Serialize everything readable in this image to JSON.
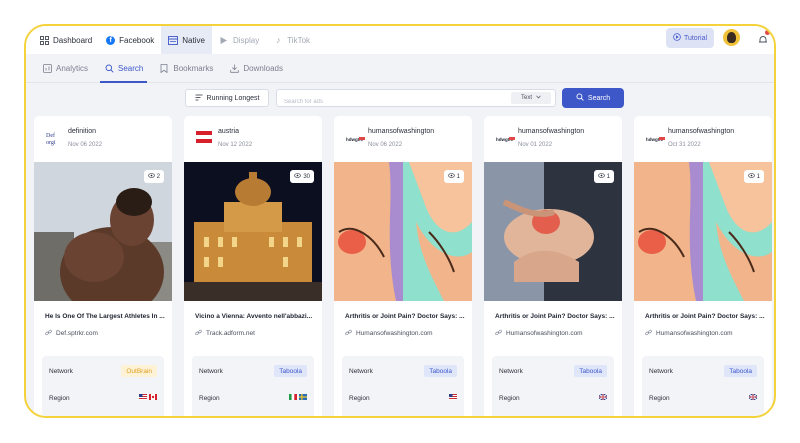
{
  "colors": {
    "accent": "#3d57c9",
    "frame": "#f3d23b",
    "taboola_bg": "#dfe6fa",
    "outbrain_text": "#e0a020"
  },
  "topnav": {
    "tabs": [
      {
        "label": "Dashboard",
        "icon": "grid-icon",
        "state": "normal"
      },
      {
        "label": "Facebook",
        "icon": "facebook-icon",
        "state": "normal"
      },
      {
        "label": "Native",
        "icon": "native-icon",
        "state": "active"
      },
      {
        "label": "Display",
        "icon": "play-icon",
        "state": "disabled"
      },
      {
        "label": "TikTok",
        "icon": "tiktok-icon",
        "state": "disabled"
      }
    ],
    "tutorial_label": "Tutorial"
  },
  "subnav": {
    "tabs": [
      {
        "label": "Analytics",
        "icon": "analytics-icon",
        "state": "normal"
      },
      {
        "label": "Search",
        "icon": "search-icon",
        "state": "active"
      },
      {
        "label": "Bookmarks",
        "icon": "bookmark-icon",
        "state": "normal"
      },
      {
        "label": "Downloads",
        "icon": "download-icon",
        "state": "normal"
      }
    ]
  },
  "search": {
    "sort_label": "Running Longest",
    "placeholder": "Search for ads",
    "type_value": "Text",
    "button_label": "Search"
  },
  "labels": {
    "network": "Network",
    "region": "Region"
  },
  "cards": [
    {
      "brand": "definition",
      "date": "Nov 06 2022",
      "views": "2",
      "title": "He Is One Of The Largest Athletes In ...",
      "url": "Def.sptrkr.com",
      "network": "OutBrain",
      "network_type": "outbrain",
      "flags": [
        "us",
        "ca"
      ],
      "image": "athlete",
      "logo": "def"
    },
    {
      "brand": "austria",
      "date": "Nov 12 2022",
      "views": "30",
      "title": "Vicino a Vienna: Avvento nell'abbazi...",
      "url": "Track.adform.net",
      "network": "Taboola",
      "network_type": "taboola",
      "flags": [
        "it",
        "se"
      ],
      "image": "palace",
      "logo": "austria"
    },
    {
      "brand": "humansofwashington",
      "date": "Nov 06 2022",
      "views": "1",
      "title": "Arthritis or Joint Pain? Doctor Says: ...",
      "url": "Humansofwashington.com",
      "network": "Taboola",
      "network_type": "taboola",
      "flags": [
        "us"
      ],
      "image": "illustration",
      "logo": "how"
    },
    {
      "brand": "humansofwashington",
      "date": "Nov 01 2022",
      "views": "1",
      "title": "Arthritis or Joint Pain? Doctor Says: ...",
      "url": "Humansofwashington.com",
      "network": "Taboola",
      "network_type": "taboola",
      "flags": [
        "gb"
      ],
      "image": "knee",
      "logo": "how"
    },
    {
      "brand": "humansofwashington",
      "date": "Oct 31 2022",
      "views": "1",
      "title": "Arthritis or Joint Pain? Doctor Says: ...",
      "url": "Humansofwashington.com",
      "network": "Taboola",
      "network_type": "taboola",
      "flags": [
        "gb"
      ],
      "image": "illustration",
      "logo": "how"
    }
  ]
}
